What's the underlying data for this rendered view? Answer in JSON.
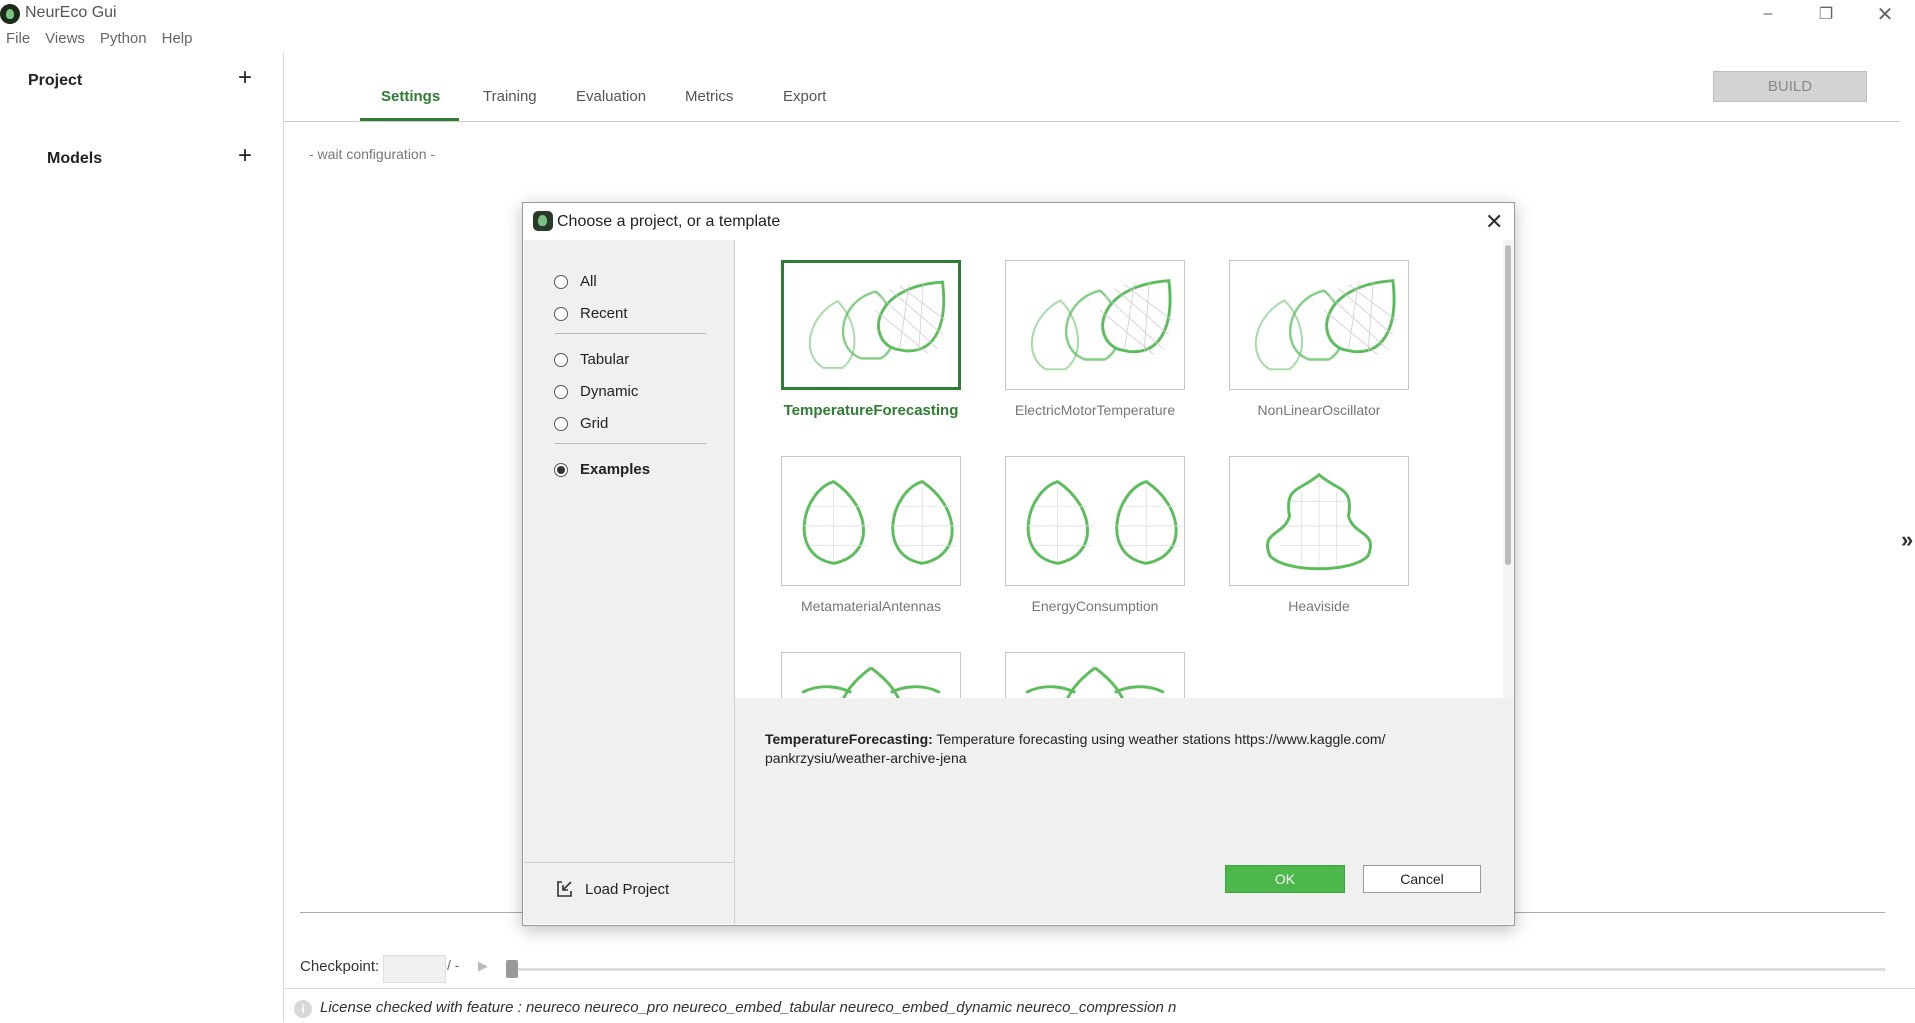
{
  "app": {
    "title": "NeurEco Gui",
    "window_controls": {
      "minimize": "–",
      "restore": "❐",
      "close": "✕"
    }
  },
  "menu": [
    "File",
    "Views",
    "Python",
    "Help"
  ],
  "sidebar": {
    "project_label": "Project",
    "models_label": "Models",
    "add_symbol": "+"
  },
  "tabs": [
    "Settings",
    "Training",
    "Evaluation",
    "Metrics",
    "Export"
  ],
  "active_tab": "Settings",
  "build_label": "BUILD",
  "wait_config": "- wait configuration -",
  "right_handle_symbol": "»",
  "checkpoint": {
    "label": "Checkpoint:",
    "value": "",
    "separator": "/ -",
    "play_symbol": "▶"
  },
  "status": {
    "info_symbol": "i",
    "license_text": "License checked with feature : neureco neureco_pro neureco_embed_tabular neureco_embed_dynamic neureco_compression n"
  },
  "dialog": {
    "title": "Choose a project, or a template",
    "close_symbol": "✕",
    "filters": [
      {
        "label": "All",
        "checked": false
      },
      {
        "label": "Recent",
        "checked": false
      },
      {
        "label": "Tabular",
        "checked": false
      },
      {
        "label": "Dynamic",
        "checked": false
      },
      {
        "label": "Grid",
        "checked": false
      },
      {
        "label": "Examples",
        "checked": true
      }
    ],
    "load_project_label": "Load Project",
    "templates": [
      {
        "name": "TemperatureForecasting",
        "icon": "three-leaves-icon",
        "selected": true
      },
      {
        "name": "ElectricMotorTemperature",
        "icon": "three-leaves-icon",
        "selected": false
      },
      {
        "name": "NonLinearOscillator",
        "icon": "three-leaves-icon",
        "selected": false
      },
      {
        "name": "MetamaterialAntennas",
        "icon": "two-drops-icon",
        "selected": false
      },
      {
        "name": "EnergyConsumption",
        "icon": "two-drops-icon",
        "selected": false
      },
      {
        "name": "Heaviside",
        "icon": "hourglass-leaf-icon",
        "selected": false
      },
      {
        "name": "",
        "icon": "lotus-icon",
        "selected": false
      },
      {
        "name": "",
        "icon": "lotus-icon",
        "selected": false
      }
    ],
    "description_title": "TemperatureForecasting:",
    "description_text": " Temperature forecasting using weather stations https://www.kaggle.com/ pankrzysiu/weather-archive-jena",
    "ok_label": "OK",
    "cancel_label": "Cancel"
  },
  "colors": {
    "accent": "#2e7d32",
    "ok": "#4cb84c",
    "leaf": "#5cbd5c"
  }
}
